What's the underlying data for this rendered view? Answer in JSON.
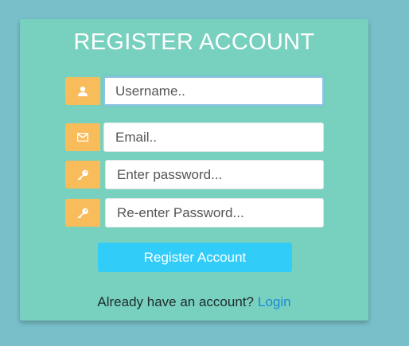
{
  "form": {
    "title": "REGISTER ACCOUNT",
    "username_placeholder": "Username..",
    "email_placeholder": "Email..",
    "password_placeholder": "Enter password...",
    "confirm_password_placeholder": "Re-enter Password...",
    "submit_label": "Register Account"
  },
  "footer": {
    "prompt": "Already have an account?",
    "login_link": "Login"
  },
  "icons": {
    "username": "user-icon",
    "email": "envelope-icon",
    "password": "key-icon",
    "confirm_password": "key-icon"
  },
  "colors": {
    "background": "#78bfc9",
    "card": "#78d1be",
    "icon_addon": "#f8bc5b",
    "button": "#32ccf9",
    "link": "#1e88d6"
  }
}
